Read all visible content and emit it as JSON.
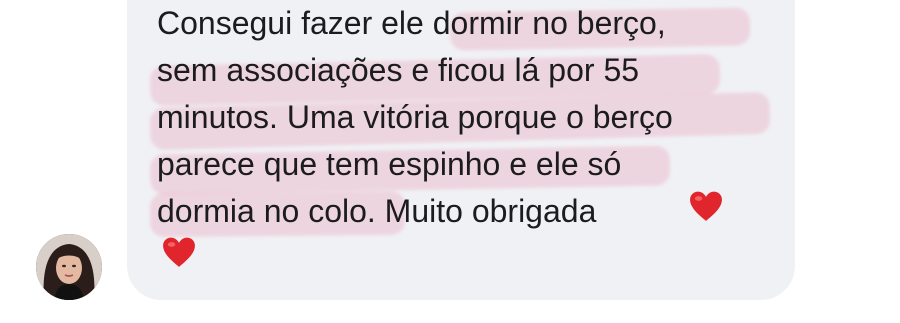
{
  "chat": {
    "message": {
      "text": "Consegui fazer ele dormir no berço,\nsem associações e ficou lá por 55\nminutos. Uma vitória porque o berço\nparece que tem espinho e ele só\ndormia no colo. Muito obrigada",
      "emoji_icons": [
        "red-heart-icon",
        "red-heart-icon"
      ]
    },
    "bubble_color": "#f0f1f4",
    "highlight_color": "#e78caa",
    "text_color": "#1c1c1e"
  }
}
